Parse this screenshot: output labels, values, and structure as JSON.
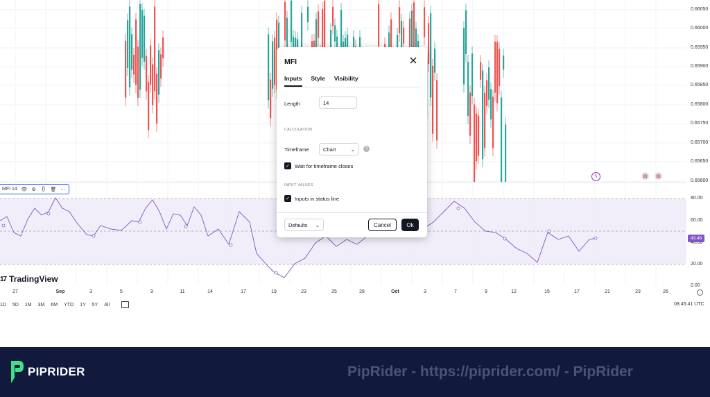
{
  "price_axis": [
    "0.66050",
    "0.66000",
    "0.65950",
    "0.65900",
    "0.65850",
    "0.65800",
    "0.65750",
    "0.65700",
    "0.65650",
    "0.65600"
  ],
  "oscillator_axis": [
    "80.00",
    "60.00",
    "40.00",
    "20.00",
    "0.00"
  ],
  "x_axis": [
    {
      "label": "27",
      "bold": false
    },
    {
      "label": "Sep",
      "bold": true
    },
    {
      "label": "3",
      "bold": false
    },
    {
      "label": "5",
      "bold": false
    },
    {
      "label": "9",
      "bold": false
    },
    {
      "label": "11",
      "bold": false
    },
    {
      "label": "14",
      "bold": false
    },
    {
      "label": "17",
      "bold": false
    },
    {
      "label": "19",
      "bold": false
    },
    {
      "label": "23",
      "bold": false
    },
    {
      "label": "25",
      "bold": false
    },
    {
      "label": "28",
      "bold": false
    },
    {
      "label": "Oct",
      "bold": true
    },
    {
      "label": "3",
      "bold": false
    },
    {
      "label": "7",
      "bold": false
    },
    {
      "label": "9",
      "bold": false
    },
    {
      "label": "12",
      "bold": false
    },
    {
      "label": "15",
      "bold": false
    },
    {
      "label": "17",
      "bold": false
    },
    {
      "label": "21",
      "bold": false
    },
    {
      "label": "23",
      "bold": false
    },
    {
      "label": "26",
      "bold": false
    }
  ],
  "indicator_legend": {
    "label": "MFI 14"
  },
  "last_value": "43.46",
  "logo_text": "TradingView",
  "ranges": [
    "1D",
    "5D",
    "1M",
    "3M",
    "6M",
    "YTD",
    "1Y",
    "5Y",
    "All"
  ],
  "utc_time": "08:45:41 UTC",
  "colors": {
    "up": "#26a69a",
    "down": "#ef5350",
    "mfi_line": "#7e57c2",
    "band_fill": "#ede7f6",
    "brand_green": "#3ee08a",
    "banner_bg": "#111a3c"
  },
  "dialog": {
    "title": "MFI",
    "tabs": [
      "Inputs",
      "Style",
      "Visibility"
    ],
    "active_tab": "Inputs",
    "length_label": "Length",
    "length_value": "14",
    "calculation_header": "CALCULATION",
    "timeframe_label": "Timeframe",
    "timeframe_value": "Chart",
    "wait_label": "Wait for timeframe closes",
    "wait_checked": true,
    "input_values_header": "INPUT VALUES",
    "status_line_label": "Inputs in status line",
    "status_line_checked": true,
    "defaults_label": "Defaults",
    "cancel_label": "Cancel",
    "ok_label": "Ok"
  },
  "banner": {
    "brand": "PIPRIDER",
    "text": "PipRider - https://piprider.com/ - PipRider"
  }
}
